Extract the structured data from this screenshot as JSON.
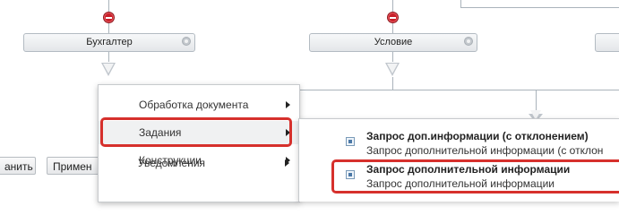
{
  "workflow": {
    "blocks": [
      {
        "label": "Бухгалтер"
      },
      {
        "label": "Условие"
      }
    ]
  },
  "buttons": {
    "save_partial": "анить",
    "apply_partial": "Примен"
  },
  "context_menu": {
    "items": [
      {
        "label": "Обработка документа",
        "has_submenu": true
      },
      {
        "label": "Задания",
        "has_submenu": true,
        "active": true
      },
      {
        "label": "Конструкции",
        "has_submenu": true
      },
      {
        "label": "Уведомления",
        "has_submenu": true
      }
    ]
  },
  "submenu": {
    "items": [
      {
        "title": "Запрос доп.информации (с отклонением)",
        "description": "Запрос дополнительной информации (с отклон"
      },
      {
        "title": "Запрос дополнительной информации",
        "description": "Запрос дополнительной информации"
      }
    ]
  },
  "colors": {
    "highlight": "#d6302c",
    "remove": "#c8202a"
  }
}
